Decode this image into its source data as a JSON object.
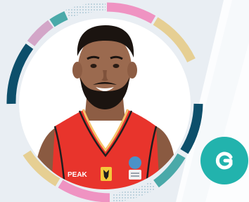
{
  "profile": {
    "photo_icon": "player-portrait",
    "jersey_brand_text": "PEAK",
    "jersey_emblem_icon": "eagle-crest-icon",
    "jersey_badge_icon": "championship-badge-icon"
  },
  "logo": {
    "icon": "g-letter-icon",
    "letter": "G"
  },
  "colors": {
    "background": "#e9eef3",
    "accent": "#22b3ad",
    "ring_navy": "#0d4f6b",
    "ring_teal": "#4aa9a9",
    "ring_pink": "#ef93c2",
    "ring_sand": "#e6cf93",
    "jersey_red": "#e8342c"
  }
}
